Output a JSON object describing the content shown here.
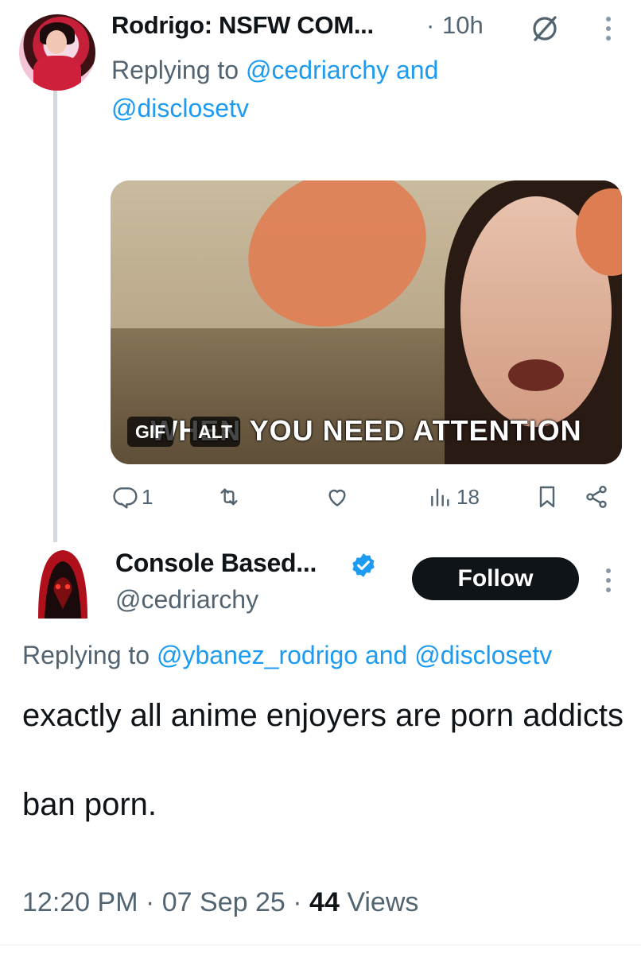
{
  "post1": {
    "author_name": "Rodrigo: NSFW COM...",
    "separator": "·",
    "time": "10h",
    "replying_prefix": "Replying to",
    "mention1": "@cedriarchy",
    "and_word": "and",
    "mention2": "@disclosetv",
    "media": {
      "caption": "WHEN YOU NEED ATTENTION",
      "gif_badge": "GIF",
      "alt_badge": "ALT"
    },
    "actions": {
      "replies": "1",
      "retweets": "",
      "likes": "",
      "views": "18"
    }
  },
  "post2": {
    "author_name": "Console Based...",
    "handle": "@cedriarchy",
    "follow_label": "Follow",
    "replying_prefix": "Replying to",
    "mention1": "@ybanez_rodrigo",
    "and_word": "and",
    "mention2": "@disclosetv",
    "text_line1": "exactly all anime enjoyers are porn addicts",
    "text_line2": "ban porn.",
    "time": "12:20 PM",
    "date": "07 Sep 25",
    "separator": "·",
    "views_count": "44",
    "views_label": "Views"
  },
  "colors": {
    "accent": "#1d9bf0",
    "secondary_text": "#536471",
    "primary_text": "#0f1419"
  },
  "icons": [
    "grok-icon",
    "more-icon",
    "reply-icon",
    "retweet-icon",
    "like-icon",
    "views-icon",
    "bookmark-icon",
    "share-icon",
    "verified-badge-icon"
  ]
}
